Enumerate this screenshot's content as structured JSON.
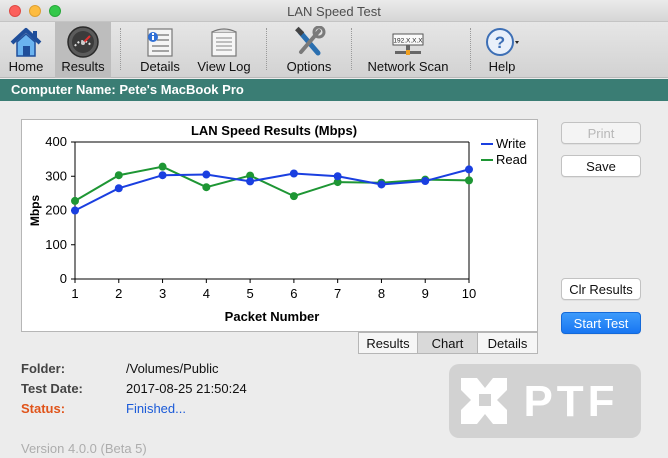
{
  "window": {
    "title": "LAN Speed Test"
  },
  "toolbar": {
    "items": [
      {
        "label": "Home",
        "icon": "home-icon"
      },
      {
        "label": "Results",
        "icon": "speedometer-icon"
      },
      {
        "label": "Details",
        "icon": "details-icon"
      },
      {
        "label": "View Log",
        "icon": "log-icon"
      },
      {
        "label": "Options",
        "icon": "tools-icon"
      },
      {
        "label": "Network Scan",
        "icon": "network-scan-icon",
        "ip_text": "192.X.X.X"
      },
      {
        "label": "Help",
        "icon": "help-icon"
      }
    ],
    "active": "Results"
  },
  "computer_name": "Computer Name: Pete's MacBook Pro",
  "chart_data": {
    "type": "line",
    "title": "LAN Speed Results (Mbps)",
    "xlabel": "Packet Number",
    "ylabel": "Mbps",
    "x": [
      1,
      2,
      3,
      4,
      5,
      6,
      7,
      8,
      9,
      10
    ],
    "xticks": [
      "1",
      "2",
      "3",
      "4",
      "5",
      "6",
      "7",
      "8",
      "9",
      "10"
    ],
    "yticks": [
      "0",
      "100",
      "200",
      "300",
      "400"
    ],
    "ylim": [
      0,
      400
    ],
    "series": [
      {
        "name": "Write",
        "color": "#1a3fe0",
        "values": [
          200,
          265,
          303,
          305,
          285,
          308,
          300,
          276,
          286,
          320
        ]
      },
      {
        "name": "Read",
        "color": "#1e9634",
        "values": [
          228,
          303,
          328,
          268,
          302,
          242,
          283,
          281,
          290,
          288
        ]
      }
    ],
    "legend": "top-right",
    "grid": false
  },
  "buttons": {
    "print": "Print",
    "save": "Save",
    "clear": "Clr Results",
    "start": "Start Test"
  },
  "tabs": [
    "Results",
    "Chart",
    "Details"
  ],
  "selected_tab": "Chart",
  "info": {
    "folder_label": "Folder:",
    "folder_value": "/Volumes/Public",
    "date_label": "Test Date:",
    "date_value": "2017-08-25 21:50:24",
    "status_label": "Status:",
    "status_value": "Finished..."
  },
  "logo_text": "PTF",
  "version": "Version 4.0.0 (Beta 5)"
}
